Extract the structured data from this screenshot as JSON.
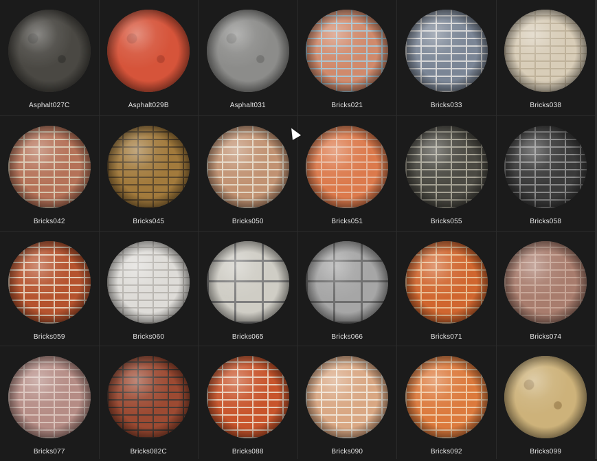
{
  "materials": [
    {
      "name": "Asphalt027C",
      "base": "#4a4843",
      "mortar": "#3a3935",
      "pattern": "noise"
    },
    {
      "name": "Asphalt029B",
      "base": "#d6543a",
      "mortar": "#b94530",
      "pattern": "noise"
    },
    {
      "name": "Asphalt031",
      "base": "#8c8c8a",
      "mortar": "#767674",
      "pattern": "noise"
    },
    {
      "name": "Bricks021",
      "base": "#d08a6c",
      "mortar": "#a9c3cf",
      "pattern": "bricks"
    },
    {
      "name": "Bricks033",
      "base": "#7b8696",
      "mortar": "#d6d6d6",
      "pattern": "bricks"
    },
    {
      "name": "Bricks038",
      "base": "#d8cdb8",
      "mortar": "#bfb29a",
      "pattern": "bricks"
    },
    {
      "name": "Bricks042",
      "base": "#b57258",
      "mortar": "#d7c5ad",
      "pattern": "bricks"
    },
    {
      "name": "Bricks045",
      "base": "#a27a3c",
      "mortar": "#5e4a2d",
      "pattern": "bricks"
    },
    {
      "name": "Bricks050",
      "base": "#c19272",
      "mortar": "#e3d6c3",
      "pattern": "bricks"
    },
    {
      "name": "Bricks051",
      "base": "#dc7a4c",
      "mortar": "#e6b59a",
      "pattern": "bricks"
    },
    {
      "name": "Bricks055",
      "base": "#4b4a43",
      "mortar": "#a5a294",
      "pattern": "bricks"
    },
    {
      "name": "Bricks058",
      "base": "#3b3b3b",
      "mortar": "#8a8a8a",
      "pattern": "bricks"
    },
    {
      "name": "Bricks059",
      "base": "#b5532e",
      "mortar": "#e2c9b3",
      "pattern": "bricks"
    },
    {
      "name": "Bricks060",
      "base": "#dedcd8",
      "mortar": "#b9b6b1",
      "pattern": "bricks"
    },
    {
      "name": "Bricks065",
      "base": "#cfcdc5",
      "mortar": "#7f7f7f",
      "pattern": "blocks"
    },
    {
      "name": "Bricks066",
      "base": "#a6a6a6",
      "mortar": "#6e6e6e",
      "pattern": "blocks"
    },
    {
      "name": "Bricks071",
      "base": "#d0662f",
      "mortar": "#e7bb91",
      "pattern": "bricks"
    },
    {
      "name": "Bricks074",
      "base": "#a87c6d",
      "mortar": "#c6a495",
      "pattern": "bricks"
    },
    {
      "name": "Bricks077",
      "base": "#b58c85",
      "mortar": "#d9c1b9",
      "pattern": "bricks"
    },
    {
      "name": "Bricks082C",
      "base": "#9c4a32",
      "mortar": "#4a3b35",
      "pattern": "bricks"
    },
    {
      "name": "Bricks088",
      "base": "#c8552c",
      "mortar": "#e7cbb6",
      "pattern": "bricks"
    },
    {
      "name": "Bricks090",
      "base": "#d9a783",
      "mortar": "#efe3d4",
      "pattern": "bricks"
    },
    {
      "name": "Bricks092",
      "base": "#dc7a3d",
      "mortar": "#efc8a3",
      "pattern": "bricks"
    },
    {
      "name": "Bricks099",
      "base": "#cdb27a",
      "mortar": "#a98d5a",
      "pattern": "noise"
    }
  ]
}
